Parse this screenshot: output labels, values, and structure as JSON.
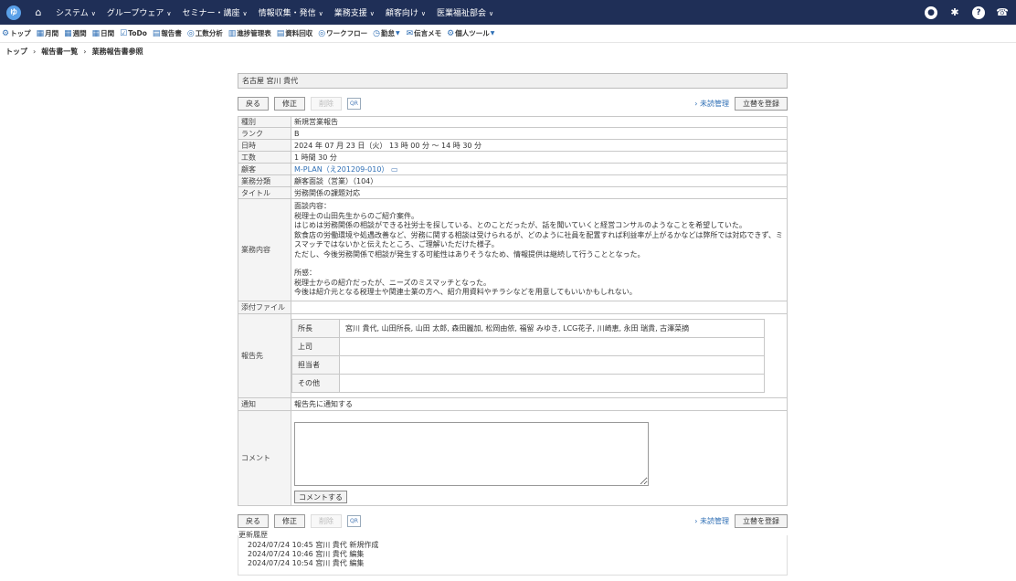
{
  "nav": {
    "logo": "ゆ",
    "items": [
      {
        "label": "システム"
      },
      {
        "label": "グループウェア"
      },
      {
        "label": "セミナー・講座"
      },
      {
        "label": "情報収集・発信"
      },
      {
        "label": "業務支援"
      },
      {
        "label": "顧客向け"
      },
      {
        "label": "医業福祉部会"
      }
    ]
  },
  "toolbar": {
    "items": [
      {
        "icon": "⚙",
        "label": "トップ"
      },
      {
        "icon": "▦",
        "label": "月間"
      },
      {
        "icon": "▦",
        "label": "週間"
      },
      {
        "icon": "▦",
        "label": "日間"
      },
      {
        "icon": "☑",
        "label": "ToDo"
      },
      {
        "icon": "▤",
        "label": "報告書"
      },
      {
        "icon": "◎",
        "label": "工数分析"
      },
      {
        "icon": "▥",
        "label": "進捗管理表"
      },
      {
        "icon": "▤",
        "label": "資料回収"
      },
      {
        "icon": "◎",
        "label": "ワークフロー"
      },
      {
        "icon": "◷",
        "label": "勤怠"
      },
      {
        "icon": "✉",
        "label": "伝言メモ"
      },
      {
        "icon": "⚙",
        "label": "個人ツール"
      }
    ]
  },
  "breadcrumb": [
    "トップ",
    "報告書一覧",
    "業務報告書参照"
  ],
  "user": "名古屋 宮川 貴代",
  "actions": {
    "back": "戻る",
    "edit": "修正",
    "delete": "削除",
    "qr": "QR",
    "unread": "› 未読管理",
    "register": "立替を登録"
  },
  "fields": {
    "type_label": "種別",
    "type": "新規営業報告",
    "rank_label": "ランク",
    "rank": "B",
    "datetime_label": "日時",
    "datetime": "2024 年 07 月 23 日（火） 13 時 00 分 ～ 14 時 30 分",
    "hours_label": "工数",
    "hours": "1 時間 30 分",
    "customer_label": "顧客",
    "customer": "M-PLAN（え201209-010）",
    "category_label": "業務分類",
    "category": "顧客面談（営業）（104）",
    "title_label": "タイトル",
    "title": "労務関係の課題対応",
    "content_label": "業務内容",
    "content": "面談内容：\n税理士の山田先生からのご紹介案件。\nはじめは労務関係の相談ができる社労士を探している、とのことだったが、話を聞いていくと経営コンサルのようなことを希望していた。\n飲食店の労働環境や処遇改善など、労務に関する相談は受けられるが、どのように社員を配置すれば利益率が上がるかなどは弊所では対応できず、ミスマッチではないかと伝えたところ、ご理解いただけた様子。\nただし、今後労務関係で相談が発生する可能性はありそうなため、情報提供は継続して行うこととなった。\n\n所感：\n税理士からの紹介だったが、ニーズのミスマッチとなった。\n今後は紹介元となる税理士や関連士業の方へ、紹介用資料やチラシなどを用意してもいいかもしれない。",
    "attach_label": "添付ファイル",
    "report_label": "報告先",
    "report": [
      {
        "label": "所長",
        "value": "宮川 貴代, 山田所長, 山田 太郎, 森田麗加, 松岡由依, 福留 みゆき, LCG花子, 川崎恵, 永田 瑞貴, 古澤菜摘"
      },
      {
        "label": "上司",
        "value": ""
      },
      {
        "label": "担当者",
        "value": ""
      },
      {
        "label": "その他",
        "value": ""
      }
    ],
    "notify_label": "通知",
    "notify": "報告先に通知する",
    "comment_label": "コメント",
    "comment_button": "コメントする"
  },
  "history": {
    "legend": "更新履歴",
    "lines": [
      "2024/07/24 10:45 宮川 貴代 新規作成",
      "2024/07/24 10:46 宮川 貴代 編集",
      "2024/07/24 10:54 宮川 貴代 編集"
    ]
  }
}
